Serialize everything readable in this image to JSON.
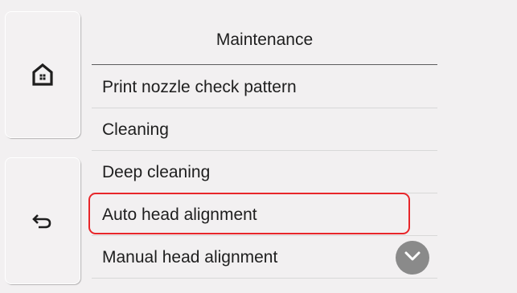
{
  "screen": {
    "title": "Maintenance"
  },
  "side": {
    "home_icon": "home-icon",
    "back_icon": "back-arrow-icon"
  },
  "menu": {
    "items": [
      {
        "label": "Print nozzle check pattern"
      },
      {
        "label": "Cleaning"
      },
      {
        "label": "Deep cleaning"
      },
      {
        "label": "Auto head alignment",
        "highlighted": true
      },
      {
        "label": "Manual head alignment"
      }
    ],
    "scroll_icon": "chevron-down-icon"
  },
  "colors": {
    "background": "#f2f0f1",
    "highlight": "#e8262a",
    "scroll_button": "#8a8a8a",
    "text": "#1e1e1e"
  }
}
